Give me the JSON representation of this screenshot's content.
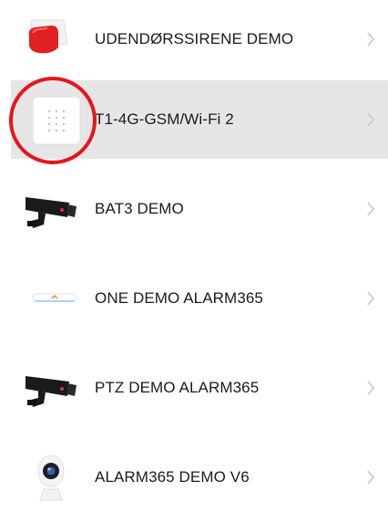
{
  "devices": [
    {
      "label": "UDENDØRSSIRENE DEMO",
      "icon": "outdoor-siren-icon"
    },
    {
      "label": "T1-4G-GSM/Wi-Fi 2",
      "icon": "alarm-panel-icon",
      "selected": true
    },
    {
      "label": "BAT3 DEMO",
      "icon": "security-camera-icon"
    },
    {
      "label": "ONE DEMO ALARM365",
      "icon": "alarm-hub-icon"
    },
    {
      "label": "PTZ DEMO ALARM365",
      "icon": "security-camera-icon"
    },
    {
      "label": "ALARM365 DEMO V6",
      "icon": "indoor-camera-icon"
    }
  ],
  "colors": {
    "highlight": "#e6e6e6",
    "annotation": "#e8141c",
    "chevron": "#c7c7cc"
  }
}
